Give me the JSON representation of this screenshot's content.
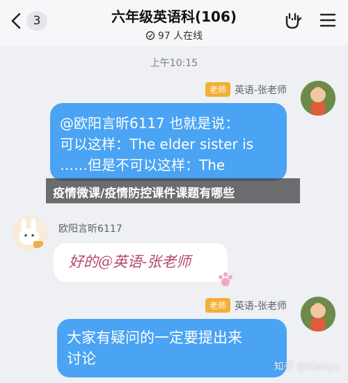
{
  "header": {
    "back_icon": "chevron-left-icon",
    "unread_count": "3",
    "title": "六年级英语科(106)",
    "online_text": "97 人在线",
    "right_icons": [
      "rock-hand-icon",
      "menu-icon"
    ]
  },
  "chat": {
    "timestamp": "上午10:15",
    "messages": [
      {
        "role_badge": "老师",
        "sender": "英语-张老师",
        "lines": [
          "@欧阳言昕6117 也就是说：",
          "可以这样：The elder sister is",
          "……但是不可以这样：The"
        ]
      },
      {
        "sender": "欧阳言昕6117",
        "handwritten_text": "好的@英语-张老师"
      },
      {
        "role_badge": "老师",
        "sender": "英语-张老师",
        "lines": [
          "大家有疑问的一定要提出来",
          "讨论"
        ]
      }
    ]
  },
  "banner": {
    "text": "疫情微课/疫情防控课件课题有哪些"
  },
  "watermark": "知乎 @Xiaoyu",
  "colors": {
    "bubble_blue": "#4aa3f3",
    "badge_orange": "#f2b035",
    "background": "#eef0f4"
  }
}
